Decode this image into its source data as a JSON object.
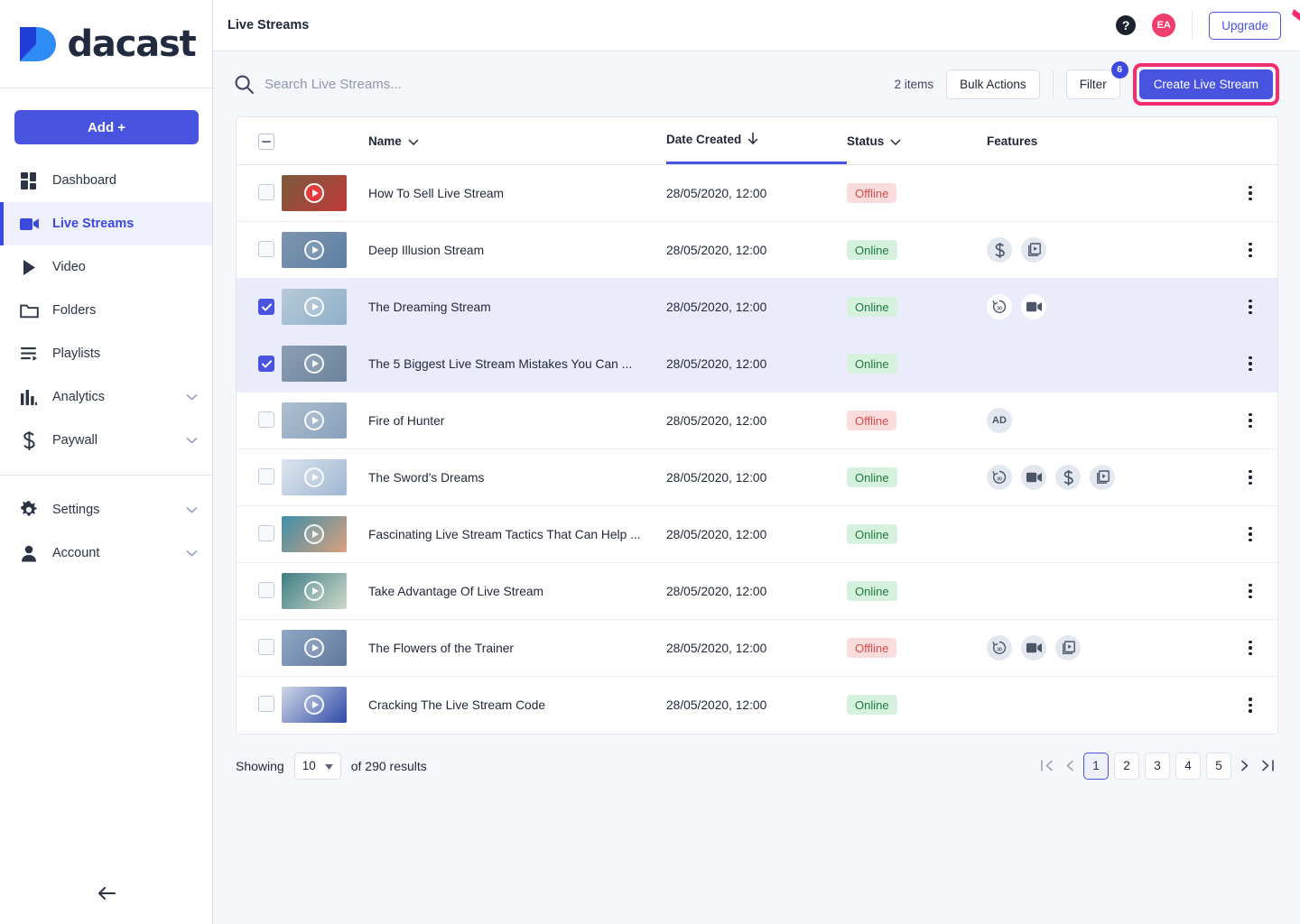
{
  "brand": {
    "name": "dacast",
    "logo_icon": "dacast-chevron-logo",
    "accent": "#4854e0"
  },
  "sidebar": {
    "add_button": "Add +",
    "items": [
      {
        "label": "Dashboard",
        "icon": "dashboard-grid-icon",
        "active": false,
        "chevron": false
      },
      {
        "label": "Live Streams",
        "icon": "video-camera-icon",
        "active": true,
        "chevron": false
      },
      {
        "label": "Video",
        "icon": "play-triangle-icon",
        "active": false,
        "chevron": false
      },
      {
        "label": "Folders",
        "icon": "folder-icon",
        "active": false,
        "chevron": false
      },
      {
        "label": "Playlists",
        "icon": "playlist-icon",
        "active": false,
        "chevron": false
      },
      {
        "label": "Analytics",
        "icon": "bar-chart-icon",
        "active": false,
        "chevron": true
      },
      {
        "label": "Paywall",
        "icon": "dollar-icon",
        "active": false,
        "chevron": true
      }
    ],
    "lower_items": [
      {
        "label": "Settings",
        "icon": "gear-icon",
        "active": false,
        "chevron": true
      },
      {
        "label": "Account",
        "icon": "person-icon",
        "active": false,
        "chevron": true
      }
    ],
    "collapse_icon": "arrow-left-icon"
  },
  "topbar": {
    "title": "Live Streams",
    "help_icon": "question-mark-icon",
    "avatar_initials": "EA",
    "avatar_color": "#ef3d6d",
    "upgrade_label": "Upgrade"
  },
  "toolbar": {
    "search_placeholder": "Search Live Streams...",
    "search_value": "",
    "search_icon": "search-icon",
    "items_count": "2 items",
    "bulk_actions_label": "Bulk Actions",
    "filter_label": "Filter",
    "filter_badge": "6",
    "create_label": "Create Live Stream",
    "highlight_color": "#f52c6e",
    "annotation_arrow": "pink-pointer-arrow"
  },
  "table": {
    "select_all_state": "indeterminate",
    "columns": [
      {
        "label": "Name",
        "sortable": true,
        "sorted": false,
        "icon": "chevron-down-icon"
      },
      {
        "label": "Date Created",
        "sortable": true,
        "sorted": true,
        "icon": "sort-arrow-down-icon"
      },
      {
        "label": "Status",
        "sortable": true,
        "sorted": false,
        "icon": "chevron-down-icon"
      },
      {
        "label": "Features",
        "sortable": false,
        "sorted": false,
        "icon": ""
      }
    ],
    "rows": [
      {
        "name": "How To Sell Live Stream",
        "date": "28/05/2020, 12:00",
        "status": "Offline",
        "selected": false,
        "features": [],
        "thumb_colors": [
          "#7a5a3c",
          "#c23b3b"
        ],
        "play_style": "red"
      },
      {
        "name": "Deep Illusion Stream",
        "date": "28/05/2020, 12:00",
        "status": "Online",
        "selected": false,
        "features": [
          "dollar-icon",
          "video-library-icon"
        ],
        "thumb_colors": [
          "#7d95ae",
          "#5d7ea3"
        ],
        "play_style": "plain"
      },
      {
        "name": "The Dreaming Stream",
        "date": "28/05/2020, 12:00",
        "status": "Online",
        "selected": true,
        "features": [
          "rewind-30-icon",
          "video-camera-icon"
        ],
        "thumb_colors": [
          "#b7cad9",
          "#8fb0c9"
        ],
        "play_style": "plain"
      },
      {
        "name": "The 5 Biggest Live Stream Mistakes You Can ...",
        "date": "28/05/2020, 12:00",
        "status": "Online",
        "selected": true,
        "features": [],
        "thumb_colors": [
          "#8a9eb3",
          "#6d849c"
        ],
        "play_style": "plain"
      },
      {
        "name": "Fire of Hunter",
        "date": "28/05/2020, 12:00",
        "status": "Offline",
        "selected": false,
        "features": [
          "AD"
        ],
        "thumb_colors": [
          "#aebfd0",
          "#87a0bb"
        ],
        "play_style": "plain"
      },
      {
        "name": "The Sword's Dreams",
        "date": "28/05/2020, 12:00",
        "status": "Online",
        "selected": false,
        "features": [
          "rewind-30-icon",
          "video-camera-icon",
          "dollar-icon",
          "video-library-icon"
        ],
        "thumb_colors": [
          "#dbe4ee",
          "#9fb6d2"
        ],
        "play_style": "plain"
      },
      {
        "name": "Fascinating Live Stream Tactics That Can Help ...",
        "date": "28/05/2020, 12:00",
        "status": "Online",
        "selected": false,
        "features": [],
        "thumb_colors": [
          "#3f8fa8",
          "#d9a07e"
        ],
        "play_style": "plain"
      },
      {
        "name": "Take Advantage Of Live Stream",
        "date": "28/05/2020, 12:00",
        "status": "Online",
        "selected": false,
        "features": [],
        "thumb_colors": [
          "#3f7e85",
          "#cfd9c9"
        ],
        "play_style": "plain"
      },
      {
        "name": "The Flowers of the Trainer",
        "date": "28/05/2020, 12:00",
        "status": "Offline",
        "selected": false,
        "features": [
          "rewind-30-icon",
          "video-camera-icon",
          "video-library-icon"
        ],
        "thumb_colors": [
          "#8fa6c4",
          "#61789c"
        ],
        "play_style": "plain"
      },
      {
        "name": "Cracking The Live Stream Code",
        "date": "28/05/2020, 12:00",
        "status": "Online",
        "selected": false,
        "features": [],
        "thumb_colors": [
          "#cfd8e6",
          "#2f49a8"
        ],
        "play_style": "plain"
      }
    ],
    "row_menu_icon": "kebab-menu-icon"
  },
  "footer": {
    "showing_label": "Showing",
    "per_page": "10",
    "results_label": "of 290 results",
    "pages": [
      "1",
      "2",
      "3",
      "4",
      "5"
    ],
    "active_page": "1",
    "first_icon": "go-first-icon",
    "prev_icon": "go-prev-icon",
    "next_icon": "go-next-icon",
    "last_icon": "go-last-icon"
  },
  "status_colors": {
    "online_bg": "#d6f2de",
    "online_fg": "#1e7a3c",
    "offline_bg": "#fadcdc",
    "offline_fg": "#d84b4b"
  }
}
